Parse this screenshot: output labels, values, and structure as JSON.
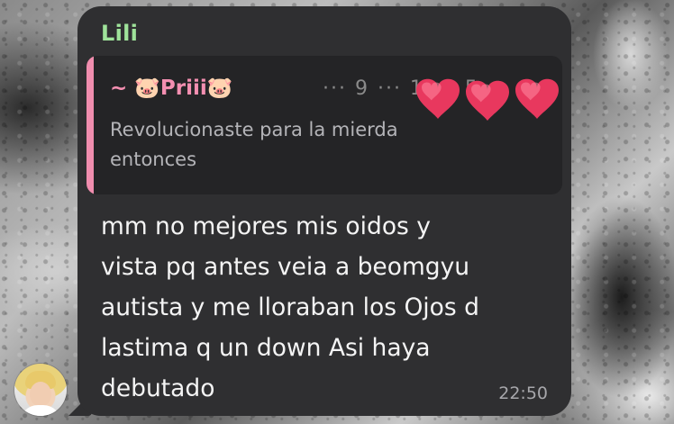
{
  "chat": {
    "message": {
      "sender": "Lili",
      "reply_preview": {
        "author": "~ 🐷Priii🐷",
        "obscured_info": "··· 9 ··· 1 ··· 5",
        "text_line1": "Revolucionaste para la mierda",
        "text_line2": "entonces",
        "accent_color": "#f08dae"
      },
      "text_lines": [
        "mm no mejores mis oidos y",
        "vista pq antes veia a beomgyu",
        "autista y me lloraban los Ojos d",
        "lastima q un down Asi haya",
        "debutado"
      ],
      "time": "22:50",
      "sender_color": "#9fe39a",
      "bubble_color": "#2f2f31"
    },
    "avatar_icon": "user-avatar-icon",
    "sticker_icons": [
      "heart-icon",
      "heart-icon",
      "heart-icon",
      "heart-icon"
    ],
    "sticker_color": "#e8385e"
  }
}
